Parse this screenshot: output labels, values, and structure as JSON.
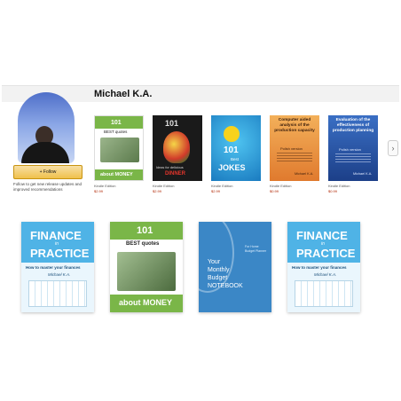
{
  "author": {
    "name": "Michael K.A.",
    "follow_label": "+ Follow",
    "follow_note": "Follow to get new release updates and improved recommendations"
  },
  "carousel": {
    "next_arrow": "›",
    "books": [
      {
        "edition": "Kindle Edition",
        "price": "$2.99",
        "t1": "101",
        "t2": "BEST quotes",
        "t3": "about MONEY"
      },
      {
        "edition": "Kindle Edition",
        "price": "$2.99",
        "t1": "101",
        "t2": "Ideas for delicious",
        "t3": "DINNER"
      },
      {
        "edition": "Kindle Edition",
        "price": "$2.99",
        "t1": "101",
        "t2": "Best",
        "t3": "JOKES"
      },
      {
        "edition": "Kindle Edition",
        "price": "$0.99",
        "t1": "Computer aided analysis of the production capacity",
        "t2": "Polish version",
        "t3": "Michael K.A."
      },
      {
        "edition": "Kindle Edition",
        "price": "$0.99",
        "t1": "Evaluation of the effectiveness of production planning",
        "t2": "Polish version",
        "t3": "Michael K.A."
      }
    ]
  },
  "featured": {
    "finance1": {
      "t1": "FINANCE",
      "t2": "in",
      "t3": "PRACTICE",
      "t4": "How to master your finances",
      "t5": "Michael K.A."
    },
    "money": {
      "t1": "101",
      "t2": "BEST quotes",
      "t3": "about MONEY"
    },
    "notebook": {
      "t1": "Your",
      "t2": "Monthly",
      "t3": "Budget",
      "t4": "NOTEBOOK",
      "t5": "For Home Budget Planner"
    },
    "finance2": {
      "t1": "FINANCE",
      "t2": "in",
      "t3": "PRACTICE",
      "t4": "How to master your finances",
      "t5": "Michael K.A."
    }
  }
}
